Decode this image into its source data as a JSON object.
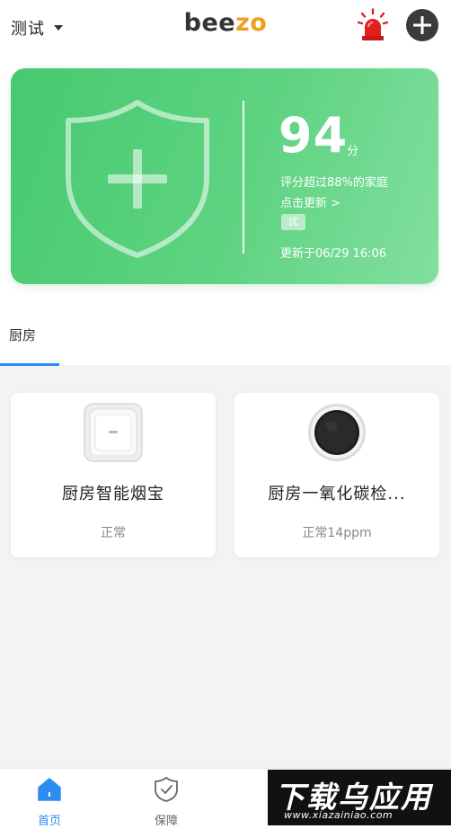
{
  "header": {
    "home_name": "测试",
    "logo_dark_1": "bee",
    "logo_accent": "zo"
  },
  "score_card": {
    "score": "94",
    "unit": "分",
    "compare": "评分超过88%的家庭",
    "refresh": "点击更新 >",
    "grade": "优",
    "updated": "更新于06/29 16:06"
  },
  "rooms": {
    "tabs": [
      {
        "label": "厨房",
        "active": true
      }
    ]
  },
  "devices": [
    {
      "name": "厨房智能烟宝",
      "status": "正常",
      "icon": "smoke-detector-icon"
    },
    {
      "name": "厨房一氧化碳检...",
      "status": "正常14ppm",
      "icon": "co-detector-icon"
    }
  ],
  "bottom_nav": {
    "items": [
      {
        "label": "首页",
        "icon": "home-icon",
        "active": true
      },
      {
        "label": "保障",
        "icon": "shield-check-icon",
        "active": false
      }
    ]
  },
  "watermark": {
    "title": "下载乌应用",
    "url": "www.xiazainiao.com"
  },
  "colors": {
    "card_green": "#4fcc78",
    "accent_blue": "#2d8cf0",
    "logo_orange": "#f0a020",
    "alarm_red": "#e02020"
  }
}
